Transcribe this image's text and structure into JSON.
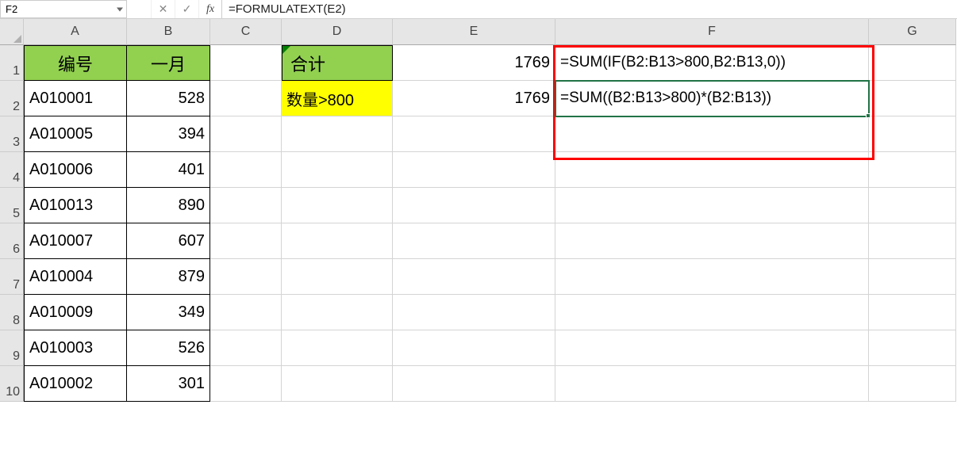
{
  "formula_bar": {
    "cell_ref": "F2",
    "formula": "=FORMULATEXT(E2)"
  },
  "col_headers": [
    "A",
    "B",
    "C",
    "D",
    "E",
    "F",
    "G"
  ],
  "row_headers": [
    "1",
    "2",
    "3",
    "4",
    "5",
    "6",
    "7",
    "8",
    "9",
    "10"
  ],
  "headers": {
    "colA": "编号",
    "colB": "一月",
    "colD": "合计"
  },
  "d2_label": "数量>800",
  "e1_value": "1769",
  "e2_value": "1769",
  "f1_formula": "=SUM(IF(B2:B13>800,B2:B13,0))",
  "f2_formula": "=SUM((B2:B13>800)*(B2:B13))",
  "table": [
    {
      "id": "A010001",
      "val": "528"
    },
    {
      "id": "A010005",
      "val": "394"
    },
    {
      "id": "A010006",
      "val": "401"
    },
    {
      "id": "A010013",
      "val": "890"
    },
    {
      "id": "A010007",
      "val": "607"
    },
    {
      "id": "A010004",
      "val": "879"
    },
    {
      "id": "A010009",
      "val": "349"
    },
    {
      "id": "A010003",
      "val": "526"
    },
    {
      "id": "A010002",
      "val": "301"
    }
  ]
}
